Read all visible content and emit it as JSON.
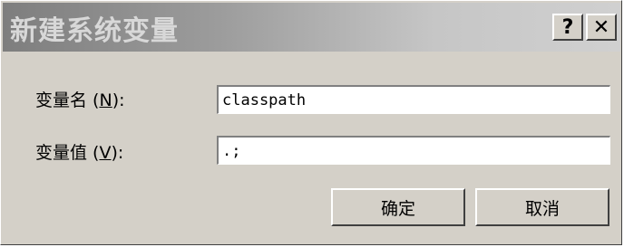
{
  "dialog": {
    "title": "新建系统变量",
    "help_glyph": "?",
    "close_glyph": "✕"
  },
  "form": {
    "name_label": "变量名",
    "name_mnemonic_open": " (",
    "name_mnemonic": "N",
    "name_mnemonic_close": "):",
    "name_value": "classpath",
    "value_label": "变量值",
    "value_mnemonic_open": " (",
    "value_mnemonic": "V",
    "value_mnemonic_close": "):",
    "value_value": ".;"
  },
  "buttons": {
    "ok_label": "确定",
    "cancel_label": "取消"
  }
}
